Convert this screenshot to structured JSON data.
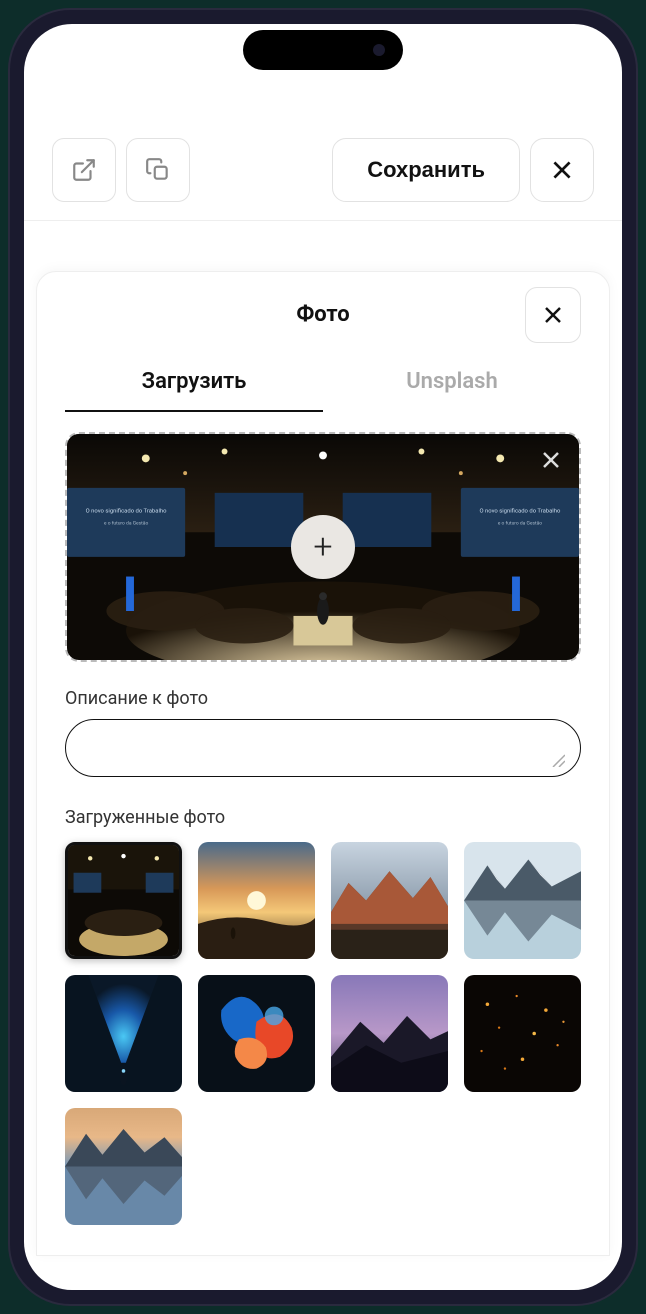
{
  "toolbar": {
    "save_label": "Сохранить"
  },
  "panel": {
    "title": "Фото",
    "tabs": {
      "upload": "Загрузить",
      "unsplash": "Unsplash"
    },
    "description_label": "Описание к фото",
    "uploaded_label": "Загруженные фото",
    "description_value": ""
  },
  "thumbs": [
    {
      "name": "conference",
      "selected": true
    },
    {
      "name": "sunset-desert",
      "selected": false
    },
    {
      "name": "mountains-red",
      "selected": false
    },
    {
      "name": "lake-reflection",
      "selected": false
    },
    {
      "name": "cave-blue",
      "selected": false
    },
    {
      "name": "abstract-ink",
      "selected": false
    },
    {
      "name": "mountain-dusk",
      "selected": false
    },
    {
      "name": "lanterns-night",
      "selected": false
    },
    {
      "name": "lake-sunset",
      "selected": false
    }
  ]
}
